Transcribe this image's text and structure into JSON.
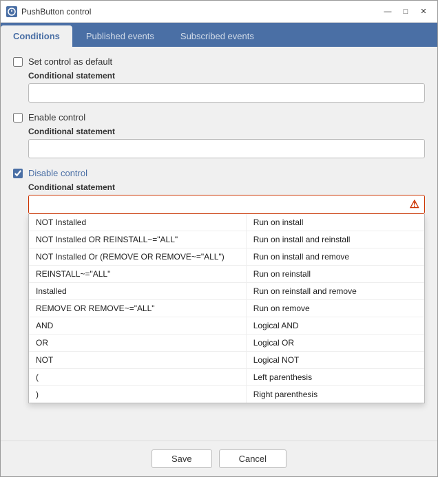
{
  "window": {
    "title": "PushButton control",
    "icon": "P"
  },
  "title_controls": {
    "minimize": "—",
    "maximize": "□",
    "close": "✕"
  },
  "tabs": [
    {
      "id": "conditions",
      "label": "Conditions",
      "active": true
    },
    {
      "id": "published",
      "label": "Published events",
      "active": false
    },
    {
      "id": "subscribed",
      "label": "Subscribed events",
      "active": false
    }
  ],
  "sections": {
    "set_default": {
      "checkbox_label": "Set control as default",
      "checked": false,
      "field_label": "Conditional statement",
      "placeholder": ""
    },
    "enable_control": {
      "checkbox_label": "Enable control",
      "checked": false,
      "field_label": "Conditional statement",
      "placeholder": ""
    },
    "disable_control": {
      "checkbox_label": "Disable control",
      "checked": true,
      "field_label": "Conditional statement",
      "placeholder": ""
    }
  },
  "dropdown_items": [
    {
      "left": "NOT Installed",
      "right": "Run on install"
    },
    {
      "left": "NOT Installed OR REINSTALL~=\"ALL\"",
      "right": "Run on install and reinstall"
    },
    {
      "left": "NOT Installed Or (REMOVE OR REMOVE~=\"ALL\")",
      "right": "Run on install and remove"
    },
    {
      "left": "REINSTALL~=\"ALL\"",
      "right": "Run on reinstall"
    },
    {
      "left": "Installed",
      "right": "Run on reinstall and remove"
    },
    {
      "left": "REMOVE OR REMOVE~=\"ALL\"",
      "right": "Run on remove"
    },
    {
      "left": "AND",
      "right": "Logical AND"
    },
    {
      "left": "OR",
      "right": "Logical OR"
    },
    {
      "left": "NOT",
      "right": "Logical NOT"
    },
    {
      "left": "(",
      "right": "Left parenthesis"
    },
    {
      "left": ")",
      "right": "Right parenthesis"
    }
  ],
  "footer": {
    "save_label": "Save",
    "cancel_label": "Cancel"
  }
}
